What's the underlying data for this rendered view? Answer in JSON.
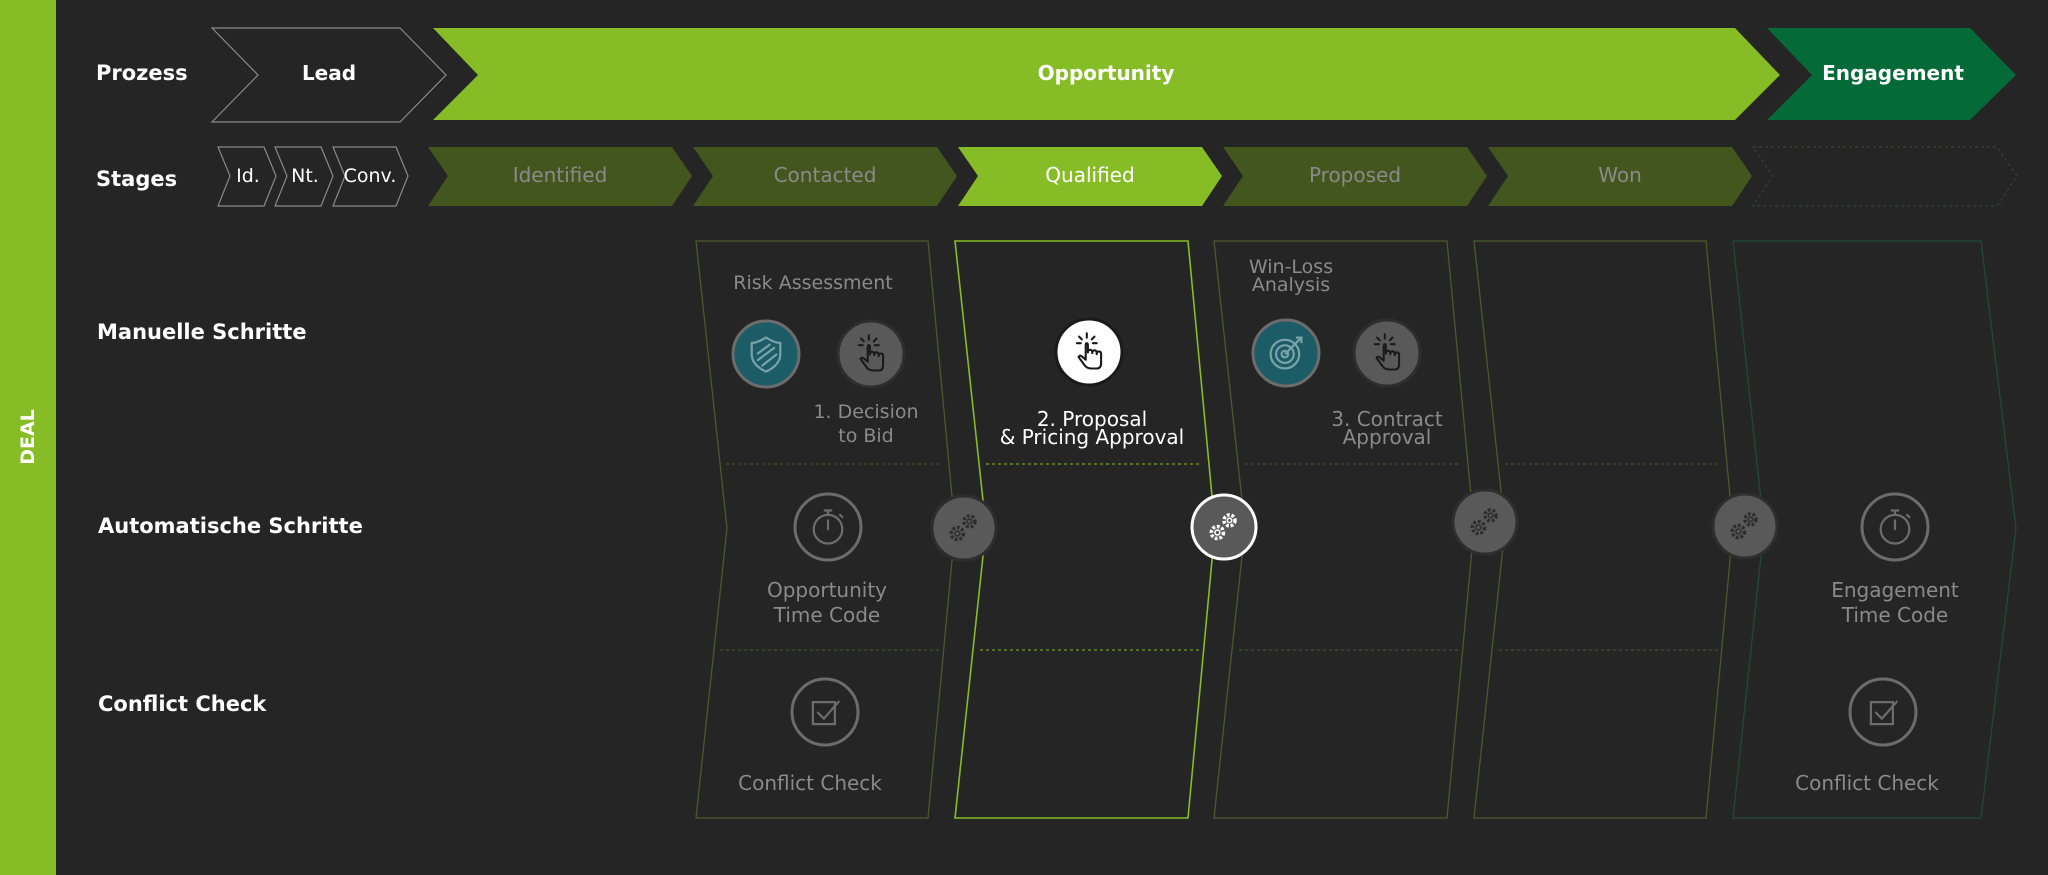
{
  "sidebar": {
    "label": "DEAL"
  },
  "row_labels": {
    "process": "Prozess",
    "stages": "Stages",
    "manual": "Manuelle Schritte",
    "automatic": "Automatische Schritte",
    "conflict": "Conflict Check"
  },
  "process": {
    "lead": "Lead",
    "opportunity": "Opportunity",
    "engagement": "Engagement"
  },
  "stages": {
    "small": [
      "Id.",
      "Nt.",
      "Conv."
    ],
    "main": [
      "Identified",
      "Contacted",
      "Qualified",
      "Proposed",
      "Won"
    ],
    "active_stage": "Qualified"
  },
  "columns": {
    "contacted": {
      "heading": "Risk Assessment",
      "step": [
        "1. Decision",
        "to Bid"
      ],
      "auto": [
        "Opportunity",
        "Time Code"
      ],
      "conflict": "Conflict Check"
    },
    "qualified": {
      "step": [
        "2. Proposal",
        "& Pricing Approval"
      ]
    },
    "proposed": {
      "heading": [
        "Win-Loss",
        "Analysis"
      ],
      "step": [
        "3. Contract",
        "Approval"
      ]
    },
    "engagement": {
      "auto": [
        "Engagement",
        "Time Code"
      ],
      "conflict": "Conflict Check"
    }
  },
  "icons": [
    "shield-icon",
    "hand-pointer-icon",
    "target-icon",
    "stopwatch-icon",
    "gears-icon",
    "checkbox-icon"
  ],
  "colors": {
    "bright_green": "#86bc25",
    "dark_green": "#43561e",
    "engagement_green": "#046a38",
    "teal": "#1b5c66",
    "background": "#252525",
    "muted_text": "#8a8a8a"
  }
}
